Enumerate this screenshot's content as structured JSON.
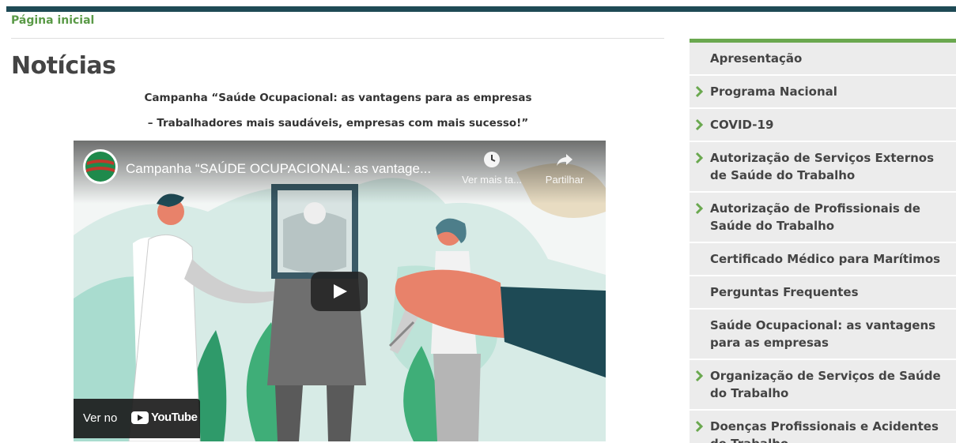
{
  "breadcrumb": {
    "home": "Página inicial"
  },
  "page": {
    "title": "Notícias",
    "subtitle_1": "Campanha “Saúde Ocupacional: as vantagens para as empresas",
    "subtitle_2": "– Trabalhadores mais saudáveis, empresas com mais sucesso!”"
  },
  "video": {
    "title": "Campanha “SAÚDE OCUPACIONAL: as vantage...",
    "watch_later": "Ver mais ta...",
    "share": "Partilhar",
    "watch_on": "Ver no",
    "platform": "YouTube"
  },
  "sidebar": {
    "items": [
      {
        "label": "Apresentação",
        "has_arrow": false
      },
      {
        "label": "Programa Nacional",
        "has_arrow": true
      },
      {
        "label": "COVID-19",
        "has_arrow": true
      },
      {
        "label": "Autorização de Serviços Externos de Saúde do Trabalho",
        "has_arrow": true
      },
      {
        "label": "Autorização de Profissionais de Saúde do Trabalho",
        "has_arrow": true
      },
      {
        "label": "Certificado Médico para Marítimos",
        "has_arrow": false
      },
      {
        "label": "Perguntas Frequentes",
        "has_arrow": false
      },
      {
        "label": "Saúde Ocupacional: as vantagens para as empresas",
        "has_arrow": false
      },
      {
        "label": "Organização de Serviços de Saúde do Trabalho",
        "has_arrow": true
      },
      {
        "label": "Doenças Profissionais e Acidentes de Trabalho",
        "has_arrow": true
      }
    ]
  },
  "colors": {
    "top_bar": "#1e4a55",
    "accent_green": "#6aa84f",
    "breadcrumb_green": "#5a9a47",
    "menu_bg": "#ececec"
  }
}
